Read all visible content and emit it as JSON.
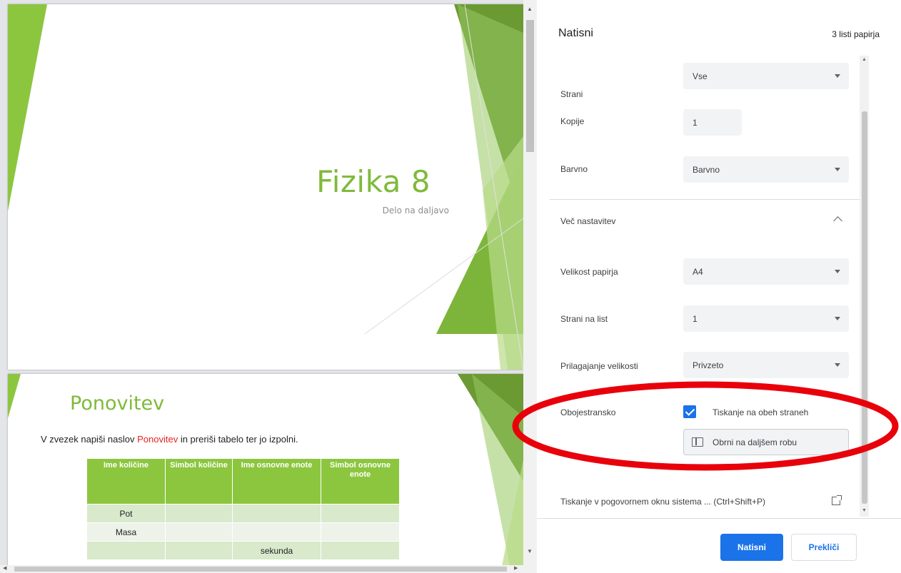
{
  "preview": {
    "slide1": {
      "title": "Fizika 8",
      "subtitle": "Delo na daljavo"
    },
    "slide2": {
      "title": "Ponovitev",
      "instruction_pre": "V zvezek napiši naslov ",
      "instruction_highlight": "Ponovitev",
      "instruction_post": " in preriši tabelo ter jo izpolni.",
      "table": {
        "headers": [
          "Ime količine",
          "Simbol količine",
          "Ime osnovne enote",
          "Simbol osnovne enote"
        ],
        "rows": [
          [
            "Pot",
            "",
            "",
            ""
          ],
          [
            "Masa",
            "",
            "",
            ""
          ],
          [
            "",
            "",
            "sekunda",
            ""
          ]
        ]
      }
    }
  },
  "panel": {
    "title": "Natisni",
    "sheet_count": "3 listi papirja",
    "pages": {
      "label": "Strani",
      "value": "Vse"
    },
    "copies": {
      "label": "Kopije",
      "value": "1"
    },
    "color": {
      "label": "Barvno",
      "value": "Barvno"
    },
    "more_settings": {
      "label": "Več nastavitev"
    },
    "paper_size": {
      "label": "Velikost papirja",
      "value": "A4"
    },
    "pages_per_sheet": {
      "label": "Strani na list",
      "value": "1"
    },
    "scale": {
      "label": "Prilagajanje velikosti",
      "value": "Privzeto"
    },
    "duplex": {
      "label": "Obojestransko",
      "checkbox_label": "Tiskanje na obeh straneh",
      "checked": true,
      "flip_value": "Obrni na daljšem robu"
    },
    "system_dialog": "Tiskanje v pogovornem oknu sistema ... (Ctrl+Shift+P)",
    "print_button": "Natisni",
    "cancel_button": "Prekliči"
  },
  "colors": {
    "accent": "#1a73e8",
    "slide_green": "#7fba3a",
    "annotation_red": "#e8000b"
  }
}
